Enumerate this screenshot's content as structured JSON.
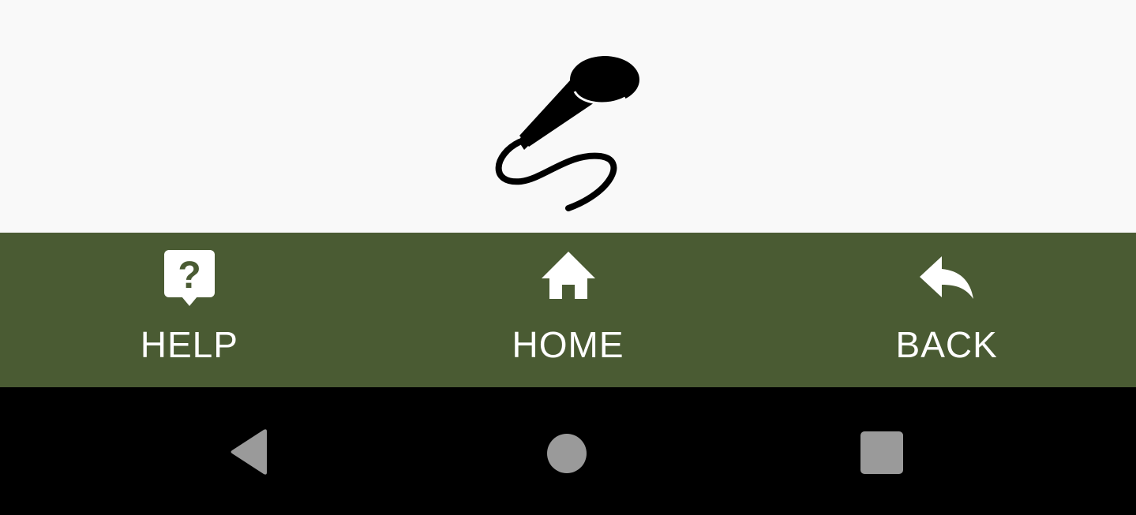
{
  "content": {
    "icon": "microphone-icon"
  },
  "bottom_bar": {
    "background": "#4a5b33",
    "text_color": "#ffffff",
    "items": [
      {
        "label": "HELP",
        "icon": "help-bubble-icon"
      },
      {
        "label": "HOME",
        "icon": "home-icon"
      },
      {
        "label": "BACK",
        "icon": "reply-back-icon"
      }
    ]
  },
  "system_nav": {
    "background": "#000000",
    "button_color": "#9a9a9a",
    "buttons": [
      {
        "icon": "nav-back-triangle-icon"
      },
      {
        "icon": "nav-home-circle-icon"
      },
      {
        "icon": "nav-recents-square-icon"
      }
    ]
  }
}
